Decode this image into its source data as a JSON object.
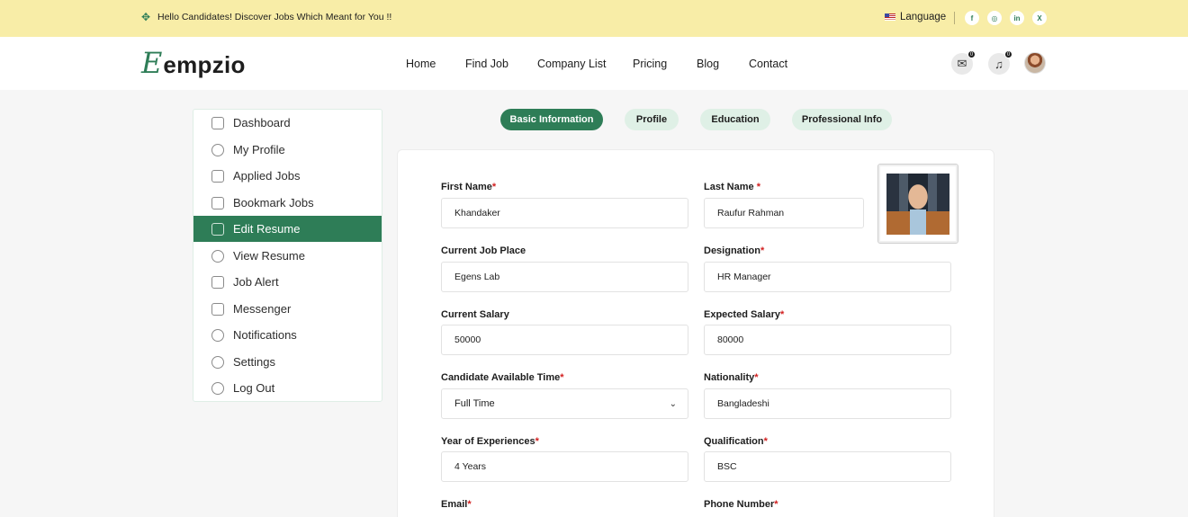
{
  "topbar": {
    "message": "Hello Candidates! Discover Jobs Which Meant for You !!",
    "language": "Language",
    "social": [
      "f",
      "◎",
      "in",
      "X"
    ]
  },
  "header": {
    "logo_mark": "E",
    "logo_text": "empzio",
    "nav": [
      "Home",
      "Find Job",
      "Company List",
      "Pricing",
      "Blog",
      "Contact"
    ],
    "mail_badge": "0",
    "notification_badge": "0"
  },
  "sidebar": {
    "items": [
      {
        "label": "Dashboard",
        "icon": "dashboard-icon"
      },
      {
        "label": "My Profile",
        "icon": "profile-icon"
      },
      {
        "label": "Applied Jobs",
        "icon": "briefcase-icon"
      },
      {
        "label": "Bookmark Jobs",
        "icon": "bookmark-icon"
      },
      {
        "label": "Edit Resume",
        "icon": "resume-icon",
        "active": true
      },
      {
        "label": "View Resume",
        "icon": "eye-icon"
      },
      {
        "label": "Job Alert",
        "icon": "alert-icon"
      },
      {
        "label": "Messenger",
        "icon": "send-icon"
      },
      {
        "label": "Notifications",
        "icon": "bell-icon"
      },
      {
        "label": "Settings",
        "icon": "gear-icon"
      },
      {
        "label": "Log Out",
        "icon": "logout-icon"
      }
    ]
  },
  "tabs": [
    "Basic Information",
    "Profile",
    "Education",
    "Professional Info"
  ],
  "form": {
    "first_name_label": "First Name",
    "first_name": "Khandaker",
    "last_name_label": "Last Name ",
    "last_name": "Raufur Rahman",
    "job_place_label": "Current Job Place",
    "job_place": "Egens Lab",
    "designation_label": "Designation",
    "designation": "HR Manager",
    "current_salary_label": "Current Salary",
    "current_salary": "50000",
    "expected_salary_label": "Expected Salary",
    "expected_salary": "80000",
    "available_time_label": "Candidate Available Time",
    "available_time": "Full Time",
    "nationality_label": "Nationality",
    "nationality": "Bangladeshi",
    "experience_label": "Year of Experiences",
    "experience": "4 Years",
    "qualification_label": "Qualification",
    "qualification": "BSC",
    "email_label": "Email",
    "phone_label": "Phone Number",
    "required_mark": "*"
  },
  "colors": {
    "accent": "#2e7d57",
    "topbar_bg": "#f8eda7",
    "tab_bg": "#dff0e6",
    "required": "#d21f1f"
  }
}
